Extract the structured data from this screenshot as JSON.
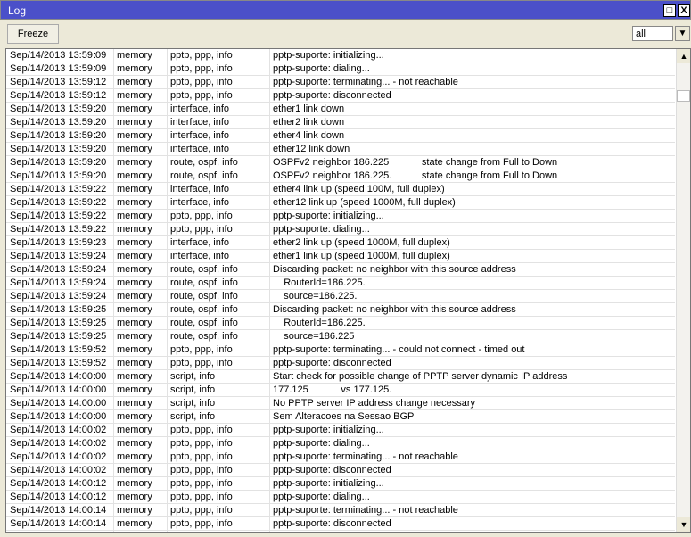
{
  "window": {
    "title": "Log",
    "maximize": "□",
    "close": "X"
  },
  "toolbar": {
    "freeze_label": "Freeze",
    "filter_value": "all",
    "filter_button": "▼"
  },
  "scroll": {
    "up": "▲",
    "down": "▼"
  },
  "rows": [
    [
      "Sep/14/2013 13:59:09",
      "memory",
      "pptp, ppp, info",
      "pptp-suporte: initializing..."
    ],
    [
      "Sep/14/2013 13:59:09",
      "memory",
      "pptp, ppp, info",
      "pptp-suporte: dialing..."
    ],
    [
      "Sep/14/2013 13:59:12",
      "memory",
      "pptp, ppp, info",
      "pptp-suporte: terminating... - not reachable"
    ],
    [
      "Sep/14/2013 13:59:12",
      "memory",
      "pptp, ppp, info",
      "pptp-suporte: disconnected"
    ],
    [
      "Sep/14/2013 13:59:20",
      "memory",
      "interface, info",
      "ether1 link down"
    ],
    [
      "Sep/14/2013 13:59:20",
      "memory",
      "interface, info",
      "ether2 link down"
    ],
    [
      "Sep/14/2013 13:59:20",
      "memory",
      "interface, info",
      "ether4 link down"
    ],
    [
      "Sep/14/2013 13:59:20",
      "memory",
      "interface, info",
      "ether12 link down"
    ],
    [
      "Sep/14/2013 13:59:20",
      "memory",
      "route, ospf, info",
      "OSPFv2 neighbor 186.225            state change from Full to Down"
    ],
    [
      "Sep/14/2013 13:59:20",
      "memory",
      "route, ospf, info",
      "OSPFv2 neighbor 186.225.           state change from Full to Down"
    ],
    [
      "Sep/14/2013 13:59:22",
      "memory",
      "interface, info",
      "ether4 link up (speed 100M, full duplex)"
    ],
    [
      "Sep/14/2013 13:59:22",
      "memory",
      "interface, info",
      "ether12 link up (speed 1000M, full duplex)"
    ],
    [
      "Sep/14/2013 13:59:22",
      "memory",
      "pptp, ppp, info",
      "pptp-suporte: initializing..."
    ],
    [
      "Sep/14/2013 13:59:22",
      "memory",
      "pptp, ppp, info",
      "pptp-suporte: dialing..."
    ],
    [
      "Sep/14/2013 13:59:23",
      "memory",
      "interface, info",
      "ether2 link up (speed 1000M, full duplex)"
    ],
    [
      "Sep/14/2013 13:59:24",
      "memory",
      "interface, info",
      "ether1 link up (speed 1000M, full duplex)"
    ],
    [
      "Sep/14/2013 13:59:24",
      "memory",
      "route, ospf, info",
      "Discarding packet: no neighbor with this source address"
    ],
    [
      "Sep/14/2013 13:59:24",
      "memory",
      "route, ospf, info",
      "    RouterId=186.225."
    ],
    [
      "Sep/14/2013 13:59:24",
      "memory",
      "route, ospf, info",
      "    source=186.225."
    ],
    [
      "Sep/14/2013 13:59:25",
      "memory",
      "route, ospf, info",
      "Discarding packet: no neighbor with this source address"
    ],
    [
      "Sep/14/2013 13:59:25",
      "memory",
      "route, ospf, info",
      "    RouterId=186.225."
    ],
    [
      "Sep/14/2013 13:59:25",
      "memory",
      "route, ospf, info",
      "    source=186.225"
    ],
    [
      "Sep/14/2013 13:59:52",
      "memory",
      "pptp, ppp, info",
      "pptp-suporte: terminating... - could not connect - timed out"
    ],
    [
      "Sep/14/2013 13:59:52",
      "memory",
      "pptp, ppp, info",
      "pptp-suporte: disconnected"
    ],
    [
      "Sep/14/2013 14:00:00",
      "memory",
      "script, info",
      "Start check for possible change of PPTP server dynamic IP address"
    ],
    [
      "Sep/14/2013 14:00:00",
      "memory",
      "script, info",
      "177.125            vs 177.125."
    ],
    [
      "Sep/14/2013 14:00:00",
      "memory",
      "script, info",
      "No PPTP server IP address change necessary"
    ],
    [
      "Sep/14/2013 14:00:00",
      "memory",
      "script, info",
      "Sem Alteracoes na Sessao BGP"
    ],
    [
      "Sep/14/2013 14:00:02",
      "memory",
      "pptp, ppp, info",
      "pptp-suporte: initializing..."
    ],
    [
      "Sep/14/2013 14:00:02",
      "memory",
      "pptp, ppp, info",
      "pptp-suporte: dialing..."
    ],
    [
      "Sep/14/2013 14:00:02",
      "memory",
      "pptp, ppp, info",
      "pptp-suporte: terminating... - not reachable"
    ],
    [
      "Sep/14/2013 14:00:02",
      "memory",
      "pptp, ppp, info",
      "pptp-suporte: disconnected"
    ],
    [
      "Sep/14/2013 14:00:12",
      "memory",
      "pptp, ppp, info",
      "pptp-suporte: initializing..."
    ],
    [
      "Sep/14/2013 14:00:12",
      "memory",
      "pptp, ppp, info",
      "pptp-suporte: dialing..."
    ],
    [
      "Sep/14/2013 14:00:14",
      "memory",
      "pptp, ppp, info",
      "pptp-suporte: terminating... - not reachable"
    ],
    [
      "Sep/14/2013 14:00:14",
      "memory",
      "pptp, ppp, info",
      "pptp-suporte: disconnected"
    ]
  ]
}
